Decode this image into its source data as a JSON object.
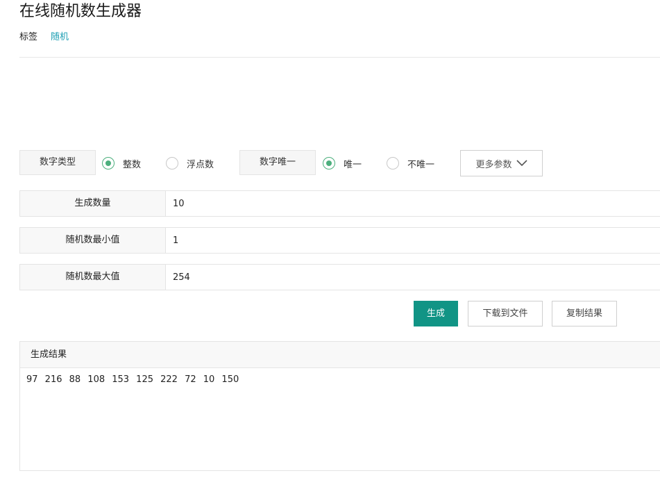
{
  "page": {
    "title": "在线随机数生成器",
    "tag_label": "标签",
    "tag_link": "随机"
  },
  "options": {
    "number_type_label": "数字类型",
    "integer_label": "整数",
    "float_label": "浮点数",
    "unique_label": "数字唯一",
    "unique_yes_label": "唯一",
    "unique_no_label": "不唯一",
    "more_params_label": "更多参数",
    "number_type_selected": "整数",
    "unique_selected": "唯一"
  },
  "form": {
    "count_label": "生成数量",
    "count_value": "10",
    "min_label": "随机数最小值",
    "min_value": "1",
    "max_label": "随机数最大值",
    "max_value": "254"
  },
  "actions": {
    "generate_label": "生成",
    "download_label": "下载到文件",
    "copy_label": "复制结果"
  },
  "result": {
    "header": "生成结果",
    "text": "97 216 88 108 153 125 222 72 10 150"
  },
  "colors": {
    "primary": "#119485",
    "link": "#1e9fb4",
    "radio_checked": "#4caf7d"
  }
}
